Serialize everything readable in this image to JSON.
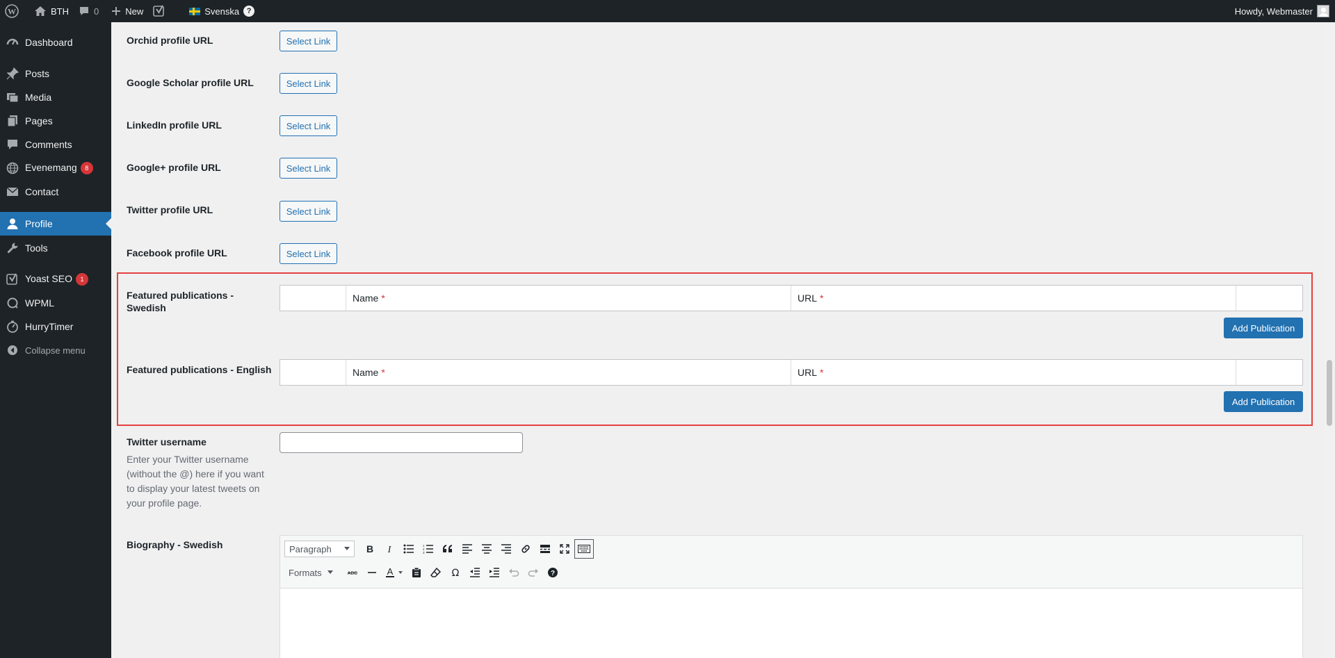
{
  "adminbar": {
    "site_name": "BTH",
    "comments_count": "0",
    "new_label": "New",
    "language": "Svenska",
    "language_help": "?",
    "greeting": "Howdy, Webmaster"
  },
  "sidebar": {
    "items": [
      {
        "label": "Dashboard",
        "icon": "dashboard-icon"
      },
      {
        "label": "Posts",
        "icon": "pin-icon"
      },
      {
        "label": "Media",
        "icon": "media-icon"
      },
      {
        "label": "Pages",
        "icon": "pages-icon"
      },
      {
        "label": "Comments",
        "icon": "comment-icon"
      },
      {
        "label": "Evenemang",
        "icon": "globe-icon",
        "badge": "8"
      },
      {
        "label": "Contact",
        "icon": "mail-icon"
      },
      {
        "label": "Profile",
        "icon": "user-icon",
        "active": true
      },
      {
        "label": "Tools",
        "icon": "wrench-icon"
      },
      {
        "label": "Yoast SEO",
        "icon": "yoast-icon",
        "badge": "1"
      },
      {
        "label": "WPML",
        "icon": "wpml-icon"
      },
      {
        "label": "HurryTimer",
        "icon": "timer-icon"
      },
      {
        "label": "Collapse menu",
        "icon": "collapse-icon"
      }
    ]
  },
  "profile_links": [
    {
      "label": "Orchid profile URL",
      "button": "Select Link"
    },
    {
      "label": "Google Scholar profile URL",
      "button": "Select Link"
    },
    {
      "label": "LinkedIn profile URL",
      "button": "Select Link"
    },
    {
      "label": "Google+ profile URL",
      "button": "Select Link"
    },
    {
      "label": "Twitter profile URL",
      "button": "Select Link"
    },
    {
      "label": "Facebook profile URL",
      "button": "Select Link"
    }
  ],
  "publications": [
    {
      "label": "Featured publications - Swedish",
      "col_name": "Name",
      "col_url": "URL",
      "required_mark": "*",
      "add_button": "Add Publication"
    },
    {
      "label": "Featured publications - English",
      "col_name": "Name",
      "col_url": "URL",
      "required_mark": "*",
      "add_button": "Add Publication"
    }
  ],
  "twitter": {
    "label": "Twitter username",
    "value": "",
    "description": "Enter your Twitter username (without the @) here if you want to display your latest tweets on your profile page."
  },
  "biography": {
    "label": "Biography - Swedish",
    "format_select": "Paragraph",
    "formats_menu": "Formats",
    "content": ""
  },
  "colors": {
    "admin_dark": "#1d2327",
    "accent": "#2271b1",
    "highlight_border": "#e4403f",
    "badge": "#d63638"
  }
}
